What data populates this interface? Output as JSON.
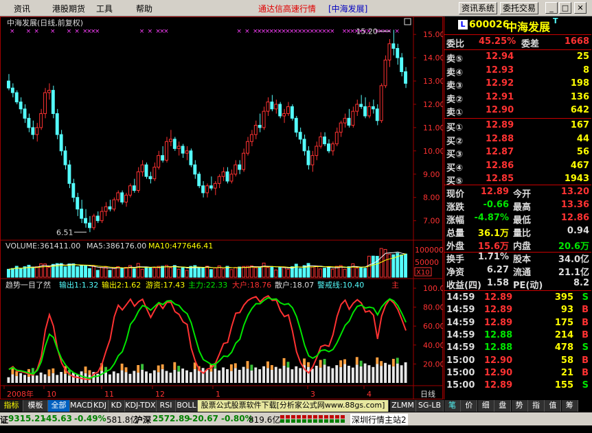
{
  "menu": {
    "items": [
      "资讯",
      "港股期货",
      "工具",
      "帮助"
    ],
    "title": "通达信高速行情",
    "title_stock": "[中海发展]",
    "btn_info": "资讯系统",
    "btn_trade": "委托交易",
    "win_min": "_",
    "win_max": "□",
    "win_close": "✕"
  },
  "chart": {
    "title": "中海发展(日线,前复权)",
    "high_label": "15.20",
    "low_label": "6.51",
    "price_ticks": [
      "15.00",
      "14.00",
      "13.00",
      "12.00",
      "11.00",
      "10.00",
      "9.00",
      "8.00",
      "7.00"
    ],
    "vol_text": "VOLUME:361411.00",
    "ma5_text": "MA5:386176.00",
    "ma10_text": "MA10:477646.41",
    "vol_ticks": [
      "100000",
      "50000"
    ],
    "vol_unit": "X10",
    "ind_name": "趋势一目了然",
    "ind_out1": "输出1:1.32",
    "ind_out2": "输出2:1.62",
    "ind_youzi": "游资:17.43",
    "ind_zhuli": "主力:22.33",
    "ind_dahu": "大户:18.76",
    "ind_sanhu": "散户:18.07",
    "ind_warn": "警戒线:10.40",
    "ind_zhu": "主",
    "ind_ticks": [
      "100.0",
      "80.00",
      "60.00",
      "40.00",
      "20.00"
    ],
    "date_labels": [
      "2008年",
      "10",
      "11",
      "12",
      "1",
      "3",
      "4"
    ],
    "period": "日线"
  },
  "chart_data": {
    "type": "candlestick",
    "symbol": "600026 中海发展",
    "ohlc": [
      [
        13.0,
        13.3,
        12.6,
        12.7
      ],
      [
        12.7,
        12.9,
        12.3,
        12.5
      ],
      [
        12.5,
        12.6,
        12.0,
        12.1
      ],
      [
        12.1,
        12.3,
        11.6,
        11.8
      ],
      [
        11.8,
        12.0,
        11.2,
        11.4
      ],
      [
        11.4,
        11.6,
        10.8,
        11.0
      ],
      [
        11.0,
        11.3,
        10.5,
        10.7
      ],
      [
        10.7,
        11.2,
        10.4,
        11.0
      ],
      [
        11.0,
        11.8,
        10.9,
        11.6
      ],
      [
        11.6,
        12.7,
        11.4,
        12.5
      ],
      [
        12.5,
        12.9,
        12.2,
        12.6
      ],
      [
        12.6,
        12.8,
        11.4,
        11.6
      ],
      [
        11.6,
        11.8,
        10.5,
        10.7
      ],
      [
        10.7,
        10.9,
        9.8,
        10.0
      ],
      [
        10.0,
        10.2,
        9.2,
        9.4
      ],
      [
        9.4,
        9.6,
        8.4,
        8.6
      ],
      [
        8.6,
        8.8,
        7.8,
        8.0
      ],
      [
        8.0,
        8.2,
        7.2,
        7.5
      ],
      [
        7.5,
        7.9,
        6.9,
        7.1
      ],
      [
        7.1,
        7.5,
        6.7,
        6.9
      ],
      [
        6.9,
        7.2,
        6.51,
        6.7
      ],
      [
        6.7,
        7.3,
        6.6,
        7.2
      ],
      [
        7.2,
        7.4,
        6.9,
        7.0
      ],
      [
        7.0,
        7.6,
        6.9,
        7.4
      ],
      [
        7.4,
        7.8,
        7.2,
        7.6
      ],
      [
        7.6,
        7.9,
        7.4,
        7.5
      ],
      [
        7.5,
        8.0,
        7.4,
        7.9
      ],
      [
        7.9,
        8.3,
        7.8,
        8.2
      ],
      [
        8.2,
        8.3,
        7.7,
        7.8
      ],
      [
        7.8,
        8.2,
        7.6,
        8.1
      ],
      [
        8.1,
        8.6,
        8.0,
        8.5
      ],
      [
        8.5,
        8.8,
        8.2,
        8.3
      ],
      [
        8.3,
        9.3,
        8.2,
        9.1
      ],
      [
        9.1,
        9.6,
        8.9,
        9.4
      ],
      [
        9.4,
        9.5,
        8.8,
        8.9
      ],
      [
        8.9,
        9.1,
        8.6,
        8.8
      ],
      [
        8.8,
        9.5,
        8.7,
        9.3
      ],
      [
        9.3,
        10.0,
        9.2,
        9.8
      ],
      [
        9.8,
        10.2,
        9.5,
        9.6
      ],
      [
        9.6,
        10.6,
        9.5,
        10.4
      ],
      [
        10.4,
        10.9,
        10.2,
        10.5
      ],
      [
        10.5,
        10.6,
        10.0,
        10.1
      ],
      [
        10.1,
        10.4,
        9.8,
        10.2
      ],
      [
        10.2,
        10.3,
        9.7,
        9.9
      ],
      [
        9.9,
        10.2,
        9.6,
        10.0
      ],
      [
        10.0,
        10.1,
        9.3,
        9.4
      ],
      [
        9.4,
        9.6,
        8.8,
        9.0
      ],
      [
        9.0,
        9.1,
        8.4,
        8.5
      ],
      [
        8.5,
        8.7,
        8.0,
        8.2
      ],
      [
        8.2,
        8.6,
        8.0,
        8.5
      ],
      [
        8.5,
        8.9,
        8.3,
        8.4
      ],
      [
        8.4,
        8.7,
        8.1,
        8.6
      ],
      [
        8.6,
        9.0,
        8.4,
        8.9
      ],
      [
        8.9,
        9.3,
        8.7,
        9.1
      ],
      [
        9.1,
        9.3,
        8.6,
        8.7
      ],
      [
        8.7,
        9.2,
        8.6,
        9.0
      ],
      [
        9.0,
        9.6,
        8.9,
        9.4
      ],
      [
        9.4,
        9.6,
        9.0,
        9.2
      ],
      [
        9.2,
        10.1,
        9.1,
        9.9
      ],
      [
        9.9,
        10.6,
        9.8,
        10.4
      ],
      [
        10.4,
        10.9,
        10.2,
        10.7
      ],
      [
        10.7,
        11.3,
        10.5,
        11.1
      ],
      [
        11.1,
        11.6,
        10.8,
        11.0
      ],
      [
        11.0,
        11.9,
        10.9,
        11.7
      ],
      [
        11.7,
        12.3,
        11.5,
        12.1
      ],
      [
        12.1,
        12.4,
        11.7,
        11.8
      ],
      [
        11.8,
        12.2,
        11.6,
        12.0
      ],
      [
        12.0,
        12.1,
        11.4,
        11.5
      ],
      [
        11.5,
        11.8,
        11.2,
        11.6
      ],
      [
        11.6,
        12.1,
        11.5,
        11.9
      ],
      [
        11.9,
        12.0,
        11.3,
        11.4
      ],
      [
        11.4,
        11.5,
        10.6,
        10.8
      ],
      [
        10.8,
        11.0,
        10.3,
        10.5
      ],
      [
        10.5,
        10.7,
        9.8,
        10.0
      ],
      [
        10.0,
        10.2,
        9.2,
        9.4
      ],
      [
        9.4,
        10.0,
        9.1,
        9.8
      ],
      [
        9.8,
        10.4,
        9.6,
        10.2
      ],
      [
        10.2,
        10.8,
        10.1,
        10.6
      ],
      [
        10.6,
        10.8,
        10.2,
        10.3
      ],
      [
        10.3,
        10.5,
        9.9,
        10.0
      ],
      [
        10.0,
        10.4,
        9.8,
        10.3
      ],
      [
        10.3,
        11.0,
        10.2,
        10.8
      ],
      [
        10.8,
        11.3,
        10.6,
        11.2
      ],
      [
        11.2,
        11.6,
        11.0,
        11.4
      ],
      [
        11.4,
        11.8,
        11.0,
        11.1
      ],
      [
        11.1,
        11.9,
        11.0,
        11.7
      ],
      [
        11.7,
        12.2,
        11.5,
        12.0
      ],
      [
        12.0,
        12.4,
        11.8,
        11.9
      ],
      [
        11.9,
        12.3,
        11.4,
        11.5
      ],
      [
        11.5,
        12.1,
        11.4,
        11.9
      ],
      [
        11.9,
        12.2,
        11.6,
        11.8
      ],
      [
        11.8,
        12.0,
        11.1,
        11.3
      ],
      [
        11.3,
        12.9,
        11.2,
        12.8
      ],
      [
        12.8,
        14.1,
        12.7,
        13.9
      ],
      [
        13.9,
        14.8,
        13.6,
        14.6
      ],
      [
        14.6,
        15.2,
        14.1,
        14.4
      ],
      [
        14.4,
        14.6,
        13.7,
        14.0
      ],
      [
        14.0,
        14.2,
        13.2,
        13.4
      ],
      [
        13.4,
        13.6,
        12.7,
        12.9
      ]
    ],
    "ylim": [
      6.5,
      15.2
    ],
    "volume_ylim": [
      0,
      110000
    ],
    "indicator_ylim": [
      0,
      100
    ]
  },
  "quote": {
    "code": "600026",
    "name": "中海发展",
    "flag": "T",
    "weibi_label": "委比",
    "weibi": "45.25%",
    "weicha_label": "委差",
    "weicha": "1668",
    "sells": [
      [
        "卖⑤",
        "12.94",
        "25"
      ],
      [
        "卖④",
        "12.93",
        "8"
      ],
      [
        "卖③",
        "12.92",
        "198"
      ],
      [
        "卖②",
        "12.91",
        "136"
      ],
      [
        "卖①",
        "12.90",
        "642"
      ]
    ],
    "buys": [
      [
        "买①",
        "12.89",
        "167"
      ],
      [
        "买②",
        "12.88",
        "44"
      ],
      [
        "买③",
        "12.87",
        "56"
      ],
      [
        "买④",
        "12.86",
        "467"
      ],
      [
        "买⑤",
        "12.85",
        "1943"
      ]
    ],
    "stats": [
      [
        "现价",
        "12.89",
        "今开",
        "13.20"
      ],
      [
        "涨跌",
        "-0.66",
        "最高",
        "13.36"
      ],
      [
        "涨幅",
        "-4.87%",
        "最低",
        "12.86"
      ],
      [
        "总量",
        "36.1万",
        "量比",
        "0.94"
      ],
      [
        "外盘",
        "15.6万",
        "内盘",
        "20.6万"
      ],
      [
        "换手",
        "1.71%",
        "股本",
        "34.0亿"
      ],
      [
        "净资",
        "6.27",
        "流通",
        "21.1亿"
      ],
      [
        "收益(四)",
        "1.58",
        "PE(动)",
        "8.2"
      ]
    ],
    "trades": [
      [
        "14:59",
        "12.89",
        "395",
        "S"
      ],
      [
        "14:59",
        "12.89",
        "93",
        "B"
      ],
      [
        "14:59",
        "12.89",
        "175",
        "B"
      ],
      [
        "14:59",
        "12.88",
        "214",
        "B"
      ],
      [
        "14:59",
        "12.88",
        "478",
        "S"
      ],
      [
        "15:00",
        "12.90",
        "58",
        "B"
      ],
      [
        "15:00",
        "12.90",
        "21",
        "B"
      ],
      [
        "15:00",
        "12.89",
        "155",
        "S"
      ]
    ]
  },
  "tabs": [
    "指标",
    "模板",
    "全部",
    "MACD",
    "KDJ",
    "KD",
    "KDJ-TDX",
    "RSI",
    "BOLL"
  ],
  "ad_text": "股票公式股票软件下载[分析家公式网www.88gs.com]",
  "tabs_right": [
    "ZLMM",
    "SG-LB"
  ],
  "rp_tabs": [
    "笔",
    "价",
    "细",
    "盘",
    "势",
    "指",
    "值",
    "筹"
  ],
  "status": {
    "sh_label": "证",
    "sh_index": "9315.21",
    "sh_chg": "-45.63",
    "sh_pct": "-0.49%",
    "sh_amt": "581.8亿",
    "sz_label": "沪深",
    "sz_index": "2572.89",
    "sz_chg": "-20.67",
    "sz_pct": "-0.80%",
    "sz_amt": "819.6亿",
    "server": "深圳行情主站2"
  },
  "colors": {
    "up": "#ff3232",
    "down": "#54fcfc",
    "yellow": "#ffff00",
    "green": "#00e600",
    "grid": "#a00000"
  }
}
